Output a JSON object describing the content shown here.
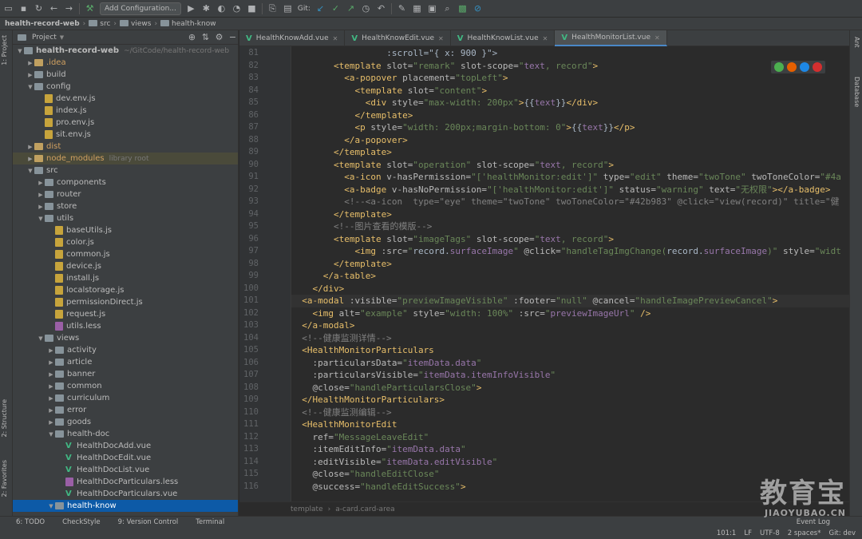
{
  "toolbar": {
    "add_config_label": "Add Configuration...",
    "git_label": "Git:"
  },
  "breadcrumb": {
    "items": [
      "health-record-web",
      "src",
      "views",
      "health-know"
    ]
  },
  "left_strip": {
    "project_tab": "1: Project",
    "structure_tab": "2: Structure",
    "favorites_tab": "2: Favorites"
  },
  "right_strip": {
    "ant_tab": "Ant",
    "database_tab": "Database"
  },
  "project_panel": {
    "title": "Project",
    "tree": [
      {
        "label": "health-record-web",
        "muted": "~/GitCode/health-record-web",
        "depth": 0,
        "kind": "dir",
        "open": true
      },
      {
        "label": ".idea",
        "depth": 1,
        "kind": "dir",
        "open": false,
        "orange": true
      },
      {
        "label": "build",
        "depth": 1,
        "kind": "dir",
        "open": false
      },
      {
        "label": "config",
        "depth": 1,
        "kind": "dir",
        "open": true
      },
      {
        "label": "dev.env.js",
        "depth": 2,
        "kind": "js"
      },
      {
        "label": "index.js",
        "depth": 2,
        "kind": "js"
      },
      {
        "label": "pro.env.js",
        "depth": 2,
        "kind": "js"
      },
      {
        "label": "sit.env.js",
        "depth": 2,
        "kind": "js"
      },
      {
        "label": "dist",
        "depth": 1,
        "kind": "dir",
        "open": false,
        "orange": true
      },
      {
        "label": "node_modules",
        "muted": "library root",
        "depth": 1,
        "kind": "dir",
        "open": false,
        "orange": true,
        "highlight": true
      },
      {
        "label": "src",
        "depth": 1,
        "kind": "dir",
        "open": true
      },
      {
        "label": "components",
        "depth": 2,
        "kind": "dir",
        "open": false
      },
      {
        "label": "router",
        "depth": 2,
        "kind": "dir",
        "open": false
      },
      {
        "label": "store",
        "depth": 2,
        "kind": "dir",
        "open": false
      },
      {
        "label": "utils",
        "depth": 2,
        "kind": "dir",
        "open": true
      },
      {
        "label": "baseUtils.js",
        "depth": 3,
        "kind": "js"
      },
      {
        "label": "color.js",
        "depth": 3,
        "kind": "js"
      },
      {
        "label": "common.js",
        "depth": 3,
        "kind": "js"
      },
      {
        "label": "device.js",
        "depth": 3,
        "kind": "js"
      },
      {
        "label": "install.js",
        "depth": 3,
        "kind": "js"
      },
      {
        "label": "localstorage.js",
        "depth": 3,
        "kind": "js"
      },
      {
        "label": "permissionDirect.js",
        "depth": 3,
        "kind": "js"
      },
      {
        "label": "request.js",
        "depth": 3,
        "kind": "js"
      },
      {
        "label": "utils.less",
        "depth": 3,
        "kind": "less"
      },
      {
        "label": "views",
        "depth": 2,
        "kind": "dir",
        "open": true
      },
      {
        "label": "activity",
        "depth": 3,
        "kind": "dir",
        "open": false
      },
      {
        "label": "article",
        "depth": 3,
        "kind": "dir",
        "open": false
      },
      {
        "label": "banner",
        "depth": 3,
        "kind": "dir",
        "open": false
      },
      {
        "label": "common",
        "depth": 3,
        "kind": "dir",
        "open": false
      },
      {
        "label": "curriculum",
        "depth": 3,
        "kind": "dir",
        "open": false
      },
      {
        "label": "error",
        "depth": 3,
        "kind": "dir",
        "open": false
      },
      {
        "label": "goods",
        "depth": 3,
        "kind": "dir",
        "open": false
      },
      {
        "label": "health-doc",
        "depth": 3,
        "kind": "dir",
        "open": true
      },
      {
        "label": "HealthDocAdd.vue",
        "depth": 4,
        "kind": "vue"
      },
      {
        "label": "HealthDocEdit.vue",
        "depth": 4,
        "kind": "vue"
      },
      {
        "label": "HealthDocList.vue",
        "depth": 4,
        "kind": "vue"
      },
      {
        "label": "HealthDocParticulars.less",
        "depth": 4,
        "kind": "less"
      },
      {
        "label": "HealthDocParticulars.vue",
        "depth": 4,
        "kind": "vue"
      },
      {
        "label": "health-know",
        "depth": 3,
        "kind": "dir",
        "open": true,
        "selected": true
      }
    ]
  },
  "editor_tabs": [
    {
      "label": "HealthKnowAdd.vue",
      "active": false
    },
    {
      "label": "HealthKnowEdit.vue",
      "active": false
    },
    {
      "label": "HealthKnowList.vue",
      "active": false
    },
    {
      "label": "HealthMonitorList.vue",
      "active": true
    }
  ],
  "code": {
    "lines": [
      {
        "n": "81",
        "segs": [
          [
            "txt",
            "                  :scroll=\"{ "
          ],
          [
            "txt",
            "x: 900"
          ],
          [
            "txt",
            " }\">"
          ]
        ]
      },
      {
        "n": "82",
        "segs": [
          [
            "tag",
            "        <template "
          ],
          [
            "attr",
            "slot="
          ],
          [
            "str",
            "\"remark\""
          ],
          [
            "attr",
            " slot-scope="
          ],
          [
            "str",
            "\""
          ],
          [
            "var",
            "text"
          ],
          [
            "str",
            ", record\""
          ],
          [
            "tag",
            ">"
          ]
        ]
      },
      {
        "n": "83",
        "segs": [
          [
            "tag",
            "          <a-popover "
          ],
          [
            "attr",
            "placement="
          ],
          [
            "str",
            "\"topLeft\""
          ],
          [
            "tag",
            ">"
          ]
        ]
      },
      {
        "n": "84",
        "segs": [
          [
            "tag",
            "            <template "
          ],
          [
            "attr",
            "slot="
          ],
          [
            "str",
            "\"content\""
          ],
          [
            "tag",
            ">"
          ]
        ]
      },
      {
        "n": "85",
        "segs": [
          [
            "tag",
            "              <div "
          ],
          [
            "attr",
            "style="
          ],
          [
            "str",
            "\"max-width: 200px\""
          ],
          [
            "tag",
            ">"
          ],
          [
            "txt",
            "{{"
          ],
          [
            "var",
            "text"
          ],
          [
            "txt",
            "}}"
          ],
          [
            "tag",
            "</div>"
          ]
        ]
      },
      {
        "n": "86",
        "segs": [
          [
            "tag",
            "            </template>"
          ]
        ]
      },
      {
        "n": "87",
        "segs": [
          [
            "tag",
            "            <p "
          ],
          [
            "attr",
            "style="
          ],
          [
            "str",
            "\"width: 200px;margin-bottom: 0\""
          ],
          [
            "tag",
            ">"
          ],
          [
            "txt",
            "{{"
          ],
          [
            "var",
            "text"
          ],
          [
            "txt",
            "}}"
          ],
          [
            "tag",
            "</p>"
          ]
        ]
      },
      {
        "n": "88",
        "segs": [
          [
            "tag",
            "          </a-popover>"
          ]
        ]
      },
      {
        "n": "89",
        "segs": [
          [
            "tag",
            "        </template>"
          ]
        ]
      },
      {
        "n": "90",
        "segs": [
          [
            "tag",
            "        <template "
          ],
          [
            "attr",
            "slot="
          ],
          [
            "str",
            "\"operation\""
          ],
          [
            "attr",
            " slot-scope="
          ],
          [
            "str",
            "\""
          ],
          [
            "var",
            "text"
          ],
          [
            "str",
            ", record\""
          ],
          [
            "tag",
            ">"
          ]
        ]
      },
      {
        "n": "91",
        "segs": [
          [
            "tag",
            "          <a-icon "
          ],
          [
            "attr",
            "v-hasPermission="
          ],
          [
            "str",
            "\"['healthMonitor:edit']\""
          ],
          [
            "attr",
            " type="
          ],
          [
            "str",
            "\"edit\""
          ],
          [
            "attr",
            " theme="
          ],
          [
            "str",
            "\"twoTone\""
          ],
          [
            "attr",
            " twoToneColor="
          ],
          [
            "str",
            "\"#4a"
          ]
        ]
      },
      {
        "n": "92",
        "segs": [
          [
            "tag",
            "          <a-badge "
          ],
          [
            "attr",
            "v-hasNoPermission="
          ],
          [
            "str",
            "\"['healthMonitor:edit']\""
          ],
          [
            "attr",
            " status="
          ],
          [
            "str",
            "\"warning\""
          ],
          [
            "attr",
            " text="
          ],
          [
            "str",
            "\"无权限\""
          ],
          [
            "tag",
            "></a-badge>"
          ]
        ]
      },
      {
        "n": "93",
        "segs": [
          [
            "cmt",
            "          <!--<a-icon  type=\"eye\" theme=\"twoTone\" twoToneColor=\"#42b983\" @click=\"view(record)\" title=\"健"
          ]
        ]
      },
      {
        "n": "94",
        "segs": [
          [
            "tag",
            "        </template>"
          ]
        ]
      },
      {
        "n": "95",
        "segs": [
          [
            "cmt",
            "        <!--图片查看的模版-->"
          ]
        ]
      },
      {
        "n": "96",
        "segs": [
          [
            "tag",
            "        <template "
          ],
          [
            "attr",
            "slot="
          ],
          [
            "str",
            "\"imageTags\""
          ],
          [
            "attr",
            " slot-scope="
          ],
          [
            "str",
            "\""
          ],
          [
            "var",
            "text"
          ],
          [
            "str",
            ", record\""
          ],
          [
            "tag",
            ">"
          ]
        ]
      },
      {
        "n": "97",
        "segs": [
          [
            "tag",
            "            <img "
          ],
          [
            "attr",
            ":src="
          ],
          [
            "str",
            "\""
          ],
          [
            "txt",
            "record."
          ],
          [
            "var",
            "surfaceImage"
          ],
          [
            "str",
            "\""
          ],
          [
            "attr",
            " @click="
          ],
          [
            "str",
            "\"handleTagImgChange("
          ],
          [
            "txt",
            "record."
          ],
          [
            "var",
            "surfaceImage"
          ],
          [
            "str",
            ")\""
          ],
          [
            "attr",
            " style="
          ],
          [
            "str",
            "\"widt"
          ]
        ]
      },
      {
        "n": "98",
        "segs": [
          [
            "tag",
            "        </template>"
          ]
        ]
      },
      {
        "n": "99",
        "segs": [
          [
            "tag",
            "      </a-table>"
          ]
        ]
      },
      {
        "n": "100",
        "segs": [
          [
            "tag",
            "    </div>"
          ]
        ]
      },
      {
        "n": "101",
        "segs": [
          [
            "tag",
            "  <a-modal "
          ],
          [
            "attr",
            ":visible="
          ],
          [
            "str",
            "\"previewImageVisible\""
          ],
          [
            "attr",
            " :footer="
          ],
          [
            "str",
            "\"null\""
          ],
          [
            "attr",
            " @cancel="
          ],
          [
            "str",
            "\"handleImagePreviewCancel\""
          ],
          [
            "tag",
            ">"
          ]
        ],
        "current": true
      },
      {
        "n": "102",
        "segs": [
          [
            "tag",
            "    <img "
          ],
          [
            "attr",
            "alt="
          ],
          [
            "str",
            "\"example\""
          ],
          [
            "attr",
            " style="
          ],
          [
            "str",
            "\"width: 100%\""
          ],
          [
            "attr",
            " :src="
          ],
          [
            "str",
            "\""
          ],
          [
            "var",
            "previewImageUrl"
          ],
          [
            "str",
            "\""
          ],
          [
            "tag",
            " />"
          ]
        ]
      },
      {
        "n": "103",
        "segs": [
          [
            "tag",
            "  </a-modal>"
          ]
        ]
      },
      {
        "n": "104",
        "segs": [
          [
            "cmt",
            "  <!--健康监测详情-->"
          ]
        ]
      },
      {
        "n": "105",
        "segs": [
          [
            "tag",
            "  <HealthMonitorParticulars"
          ]
        ]
      },
      {
        "n": "106",
        "segs": [
          [
            "attr",
            "    :particularsData="
          ],
          [
            "str",
            "\""
          ],
          [
            "var",
            "itemData.data"
          ],
          [
            "str",
            "\""
          ]
        ]
      },
      {
        "n": "107",
        "segs": [
          [
            "attr",
            "    :particularsVisible="
          ],
          [
            "str",
            "\""
          ],
          [
            "var",
            "itemData.itemInfoVisible"
          ],
          [
            "str",
            "\""
          ]
        ]
      },
      {
        "n": "108",
        "segs": [
          [
            "attr",
            "    @close="
          ],
          [
            "str",
            "\"handleParticularsClose\""
          ],
          [
            "tag",
            ">"
          ]
        ]
      },
      {
        "n": "109",
        "segs": [
          [
            "tag",
            "  </HealthMonitorParticulars>"
          ]
        ]
      },
      {
        "n": "110",
        "segs": [
          [
            "cmt",
            "  <!--健康监测编辑-->"
          ]
        ]
      },
      {
        "n": "111",
        "segs": [
          [
            "tag",
            "  <HealthMonitorEdit"
          ]
        ]
      },
      {
        "n": "112",
        "segs": [
          [
            "attr",
            "    ref="
          ],
          [
            "str",
            "\"MessageLeaveEdit\""
          ]
        ]
      },
      {
        "n": "113",
        "segs": [
          [
            "attr",
            "    :itemEditInfo="
          ],
          [
            "str",
            "\""
          ],
          [
            "var",
            "itemData.data"
          ],
          [
            "str",
            "\""
          ]
        ]
      },
      {
        "n": "114",
        "segs": [
          [
            "attr",
            "    :editVisible="
          ],
          [
            "str",
            "\""
          ],
          [
            "var",
            "itemData.editVisible"
          ],
          [
            "str",
            "\""
          ]
        ]
      },
      {
        "n": "115",
        "segs": [
          [
            "attr",
            "    @close="
          ],
          [
            "str",
            "\"handleEditClose\""
          ]
        ]
      },
      {
        "n": "116",
        "segs": [
          [
            "attr",
            "    @success="
          ],
          [
            "str",
            "\"handleEditSuccess\""
          ],
          [
            "tag",
            ">"
          ]
        ]
      }
    ]
  },
  "editor_breadcrumb": {
    "items": [
      "template",
      "a-card.card-area"
    ]
  },
  "status": {
    "tabs": [
      {
        "label": "6: TODO"
      },
      {
        "label": "CheckStyle"
      },
      {
        "label": "9: Version Control"
      },
      {
        "label": "Terminal"
      }
    ],
    "event_log": "Event Log",
    "position": "101:1",
    "line_sep": "LF",
    "encoding": "UTF-8",
    "indent": "2 spaces*",
    "git_branch": "Git: dev"
  },
  "watermark": {
    "big": "教育宝",
    "small": "JIAOYUBAO.CN"
  },
  "colors": {
    "bg": "#2b2b2b",
    "panel": "#3c3f41",
    "selection": "#0d5aa7",
    "tag": "#e8bf6a",
    "string": "#6a8759",
    "variable": "#9876aa",
    "comment": "#808080"
  }
}
